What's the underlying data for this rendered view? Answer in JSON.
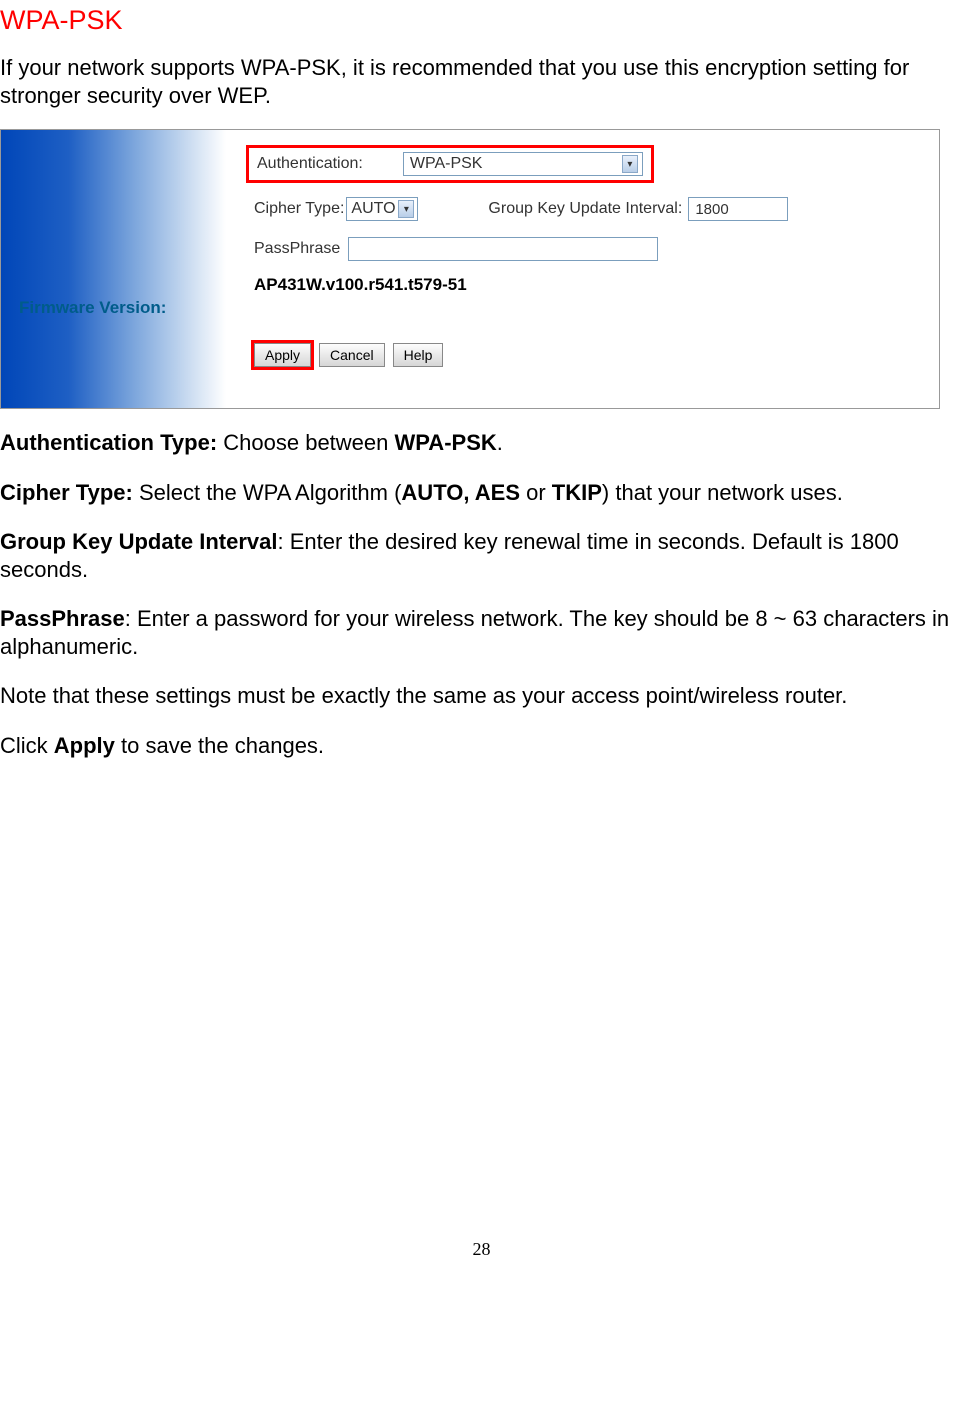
{
  "heading": "WPA-PSK",
  "intro": "If your network supports WPA-PSK, it is recommended that you use this encryption setting for stronger security over WEP.",
  "screenshot": {
    "firmwareLabel": "Firmware Version:",
    "authLabel": "Authentication:",
    "authValue": "WPA-PSK",
    "cipherLabel": "Cipher Type:",
    "cipherValue": "AUTO",
    "groupKeyLabel": "Group Key Update Interval:",
    "groupKeyValue": "1800",
    "passLabel": "PassPhrase",
    "passValue": "",
    "firmwareValue": "AP431W.v100.r541.t579-51",
    "buttons": {
      "apply": "Apply",
      "cancel": "Cancel",
      "help": "Help"
    }
  },
  "paragraphs": {
    "authType": {
      "bold1": "Authentication Type:",
      "text1": " Choose between ",
      "bold2": "WPA-PSK",
      "text2": "."
    },
    "cipherType": {
      "bold1": "Cipher Type:",
      "text1": " Select the WPA Algorithm (",
      "bold2": "AUTO, AES",
      "text2": " or ",
      "bold3": "TKIP",
      "text3": ") that your network uses."
    },
    "groupKey": {
      "bold1": "Group Key Update Interval",
      "text1": ": Enter the desired key renewal time in seconds. Default is 1800 seconds."
    },
    "passPhrase": {
      "bold1": "PassPhrase",
      "text1": ": Enter a password for your wireless network. The key should be 8 ~ 63 characters in alphanumeric."
    },
    "note": "Note that these settings must be exactly the same as your access point/wireless router.",
    "click": {
      "text1": "Click ",
      "bold1": "Apply",
      "text2": " to save the changes."
    }
  },
  "pageNumber": "28"
}
